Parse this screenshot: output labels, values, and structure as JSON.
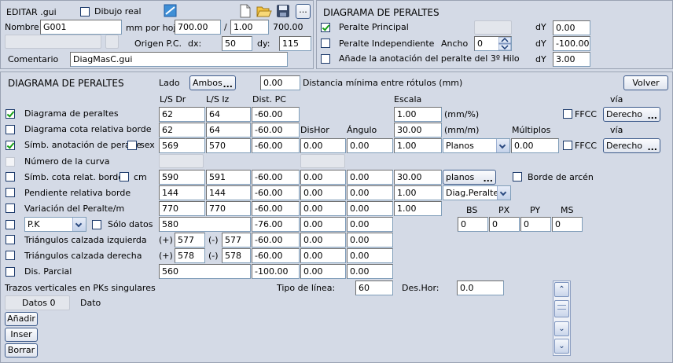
{
  "editar": {
    "title": "EDITAR .gui",
    "dibujo_real_label": "Dibujo real",
    "dibujo_real_checked": false,
    "nombre_label": "Nombre:",
    "nombre_value": "G001",
    "mm_por_hoja_label": "mm por hoja:",
    "mm_por_hoja_value": "700.00",
    "slash": "/",
    "ratio_value": "1.00",
    "ratio_result": "700.00",
    "origen_label": "Origen P.C.",
    "dx_label": "dx:",
    "dx_value": "50",
    "dy_label": "dy:",
    "dy_value": "115",
    "comentario_label": "Comentario",
    "comentario_value": "DiagMasC.gui",
    "browse_label": "..."
  },
  "diagrama_top": {
    "title": "DIAGRAMA DE PERALTES",
    "rows": [
      {
        "label": "Peralte Principal",
        "checked": true,
        "dy_label": "dY",
        "dy_value": "0.00"
      },
      {
        "label": "Peralte Independiente",
        "checked": false,
        "ancho_label": "Ancho",
        "ancho_value": "0",
        "dy_label": "dY",
        "dy_value": "-100.00"
      },
      {
        "label": "Añade la anotación del peralte del 3º Hilo",
        "checked": false,
        "dy_label": "dY",
        "dy_value": "3.00"
      }
    ]
  },
  "main": {
    "title": "DIAGRAMA DE PERALTES",
    "lado_label": "Lado",
    "lado_button": "Ambos",
    "dist_value": "0.00",
    "dist_label": "Distancia mínima entre rótulos (mm)",
    "volver_label": "Volver",
    "headers": {
      "ls_dr": "L/S Dr",
      "ls_iz": "L/S Iz",
      "dist_pc": "Dist. PC",
      "escala": "Escala",
      "via": "vía",
      "dishor": "DisHor",
      "angulo": "Ángulo",
      "multiplos": "Múltiplos",
      "via2": "vía"
    },
    "rows": [
      {
        "label": "Diagrama de peraltes",
        "checked": true,
        "dr": "62",
        "iz": "64",
        "pc": "-60.00",
        "escala": "1.00",
        "unit": "(mm/%)",
        "ffcc_label": "FFCC",
        "ffcc_checked": false,
        "via_button": "Derecho"
      },
      {
        "label": "Diagrama cota relativa borde",
        "checked": false,
        "dr": "62",
        "iz": "64",
        "pc": "-60.00",
        "escala": "30.00",
        "unit": "(mm/m)"
      },
      {
        "label": "Símb. anotación de peralte",
        "checked": true,
        "sex_label": "sex",
        "sex_checked": false,
        "dr": "569",
        "iz": "570",
        "pc": "-60.00",
        "dishor": "0.00",
        "angulo": "0.00",
        "escala": "1.00",
        "select": "Planos",
        "multiplos": "0.00",
        "ffcc_label": "FFCC",
        "ffcc_checked": false,
        "via_button": "Derecho"
      },
      {
        "label": "Número de la curva",
        "checked": false
      },
      {
        "label": "Símb. cota relat. borde",
        "checked": false,
        "cm_label": "cm",
        "cm_checked": false,
        "dr": "590",
        "iz": "591",
        "pc": "-60.00",
        "dishor": "0.00",
        "angulo": "0.00",
        "escala": "30.00",
        "button": "planos",
        "borde_label": "Borde de arcén",
        "borde_checked": false
      },
      {
        "label": "Pendiente relativa borde",
        "checked": false,
        "dr": "144",
        "iz": "144",
        "pc": "-60.00",
        "dishor": "0.00",
        "angulo": "0.00",
        "escala": "1.00",
        "select": "Diag.Peraltes"
      },
      {
        "label": "Variación del Peralte/m",
        "checked": false,
        "dr": "770",
        "iz": "770",
        "pc": "-60.00",
        "dishor": "0.00",
        "angulo": "0.00",
        "escala": "1.00"
      },
      {
        "label": "",
        "checked": false,
        "select": "P.K",
        "solo_label": "Sólo datos",
        "solo_checked": false,
        "dr": "580",
        "pc": "-76.00",
        "dishor": "0.00",
        "angulo": "0.00"
      },
      {
        "label": "Triángulos calzada izquierda",
        "checked": false,
        "plus": "(+)",
        "dr": "577",
        "minus": "(-)",
        "iz": "577",
        "pc": "-60.00",
        "dishor": "0.00",
        "angulo": "0.00"
      },
      {
        "label": "Triángulos calzada derecha",
        "checked": false,
        "plus": "(+)",
        "dr": "578",
        "minus": "(-)",
        "iz": "578",
        "pc": "-60.00",
        "dishor": "0.00",
        "angulo": "0.00"
      },
      {
        "label": "Dis. Parcial",
        "checked": false,
        "dr": "560",
        "pc": "-100.00",
        "dishor": "0.00",
        "angulo": "0.00"
      }
    ],
    "bs_headers": [
      "BS",
      "PX",
      "PY",
      "MS"
    ],
    "bs_values": [
      "0",
      "0",
      "0",
      "0"
    ],
    "trazos_label": "Trazos verticales en PKs singulares",
    "tipo_linea_label": "Tipo de línea:",
    "tipo_linea_value": "60",
    "des_hor_label": "Des.Hor:",
    "des_hor_value": "0.0",
    "datos_label": "Datos 0",
    "dato_label": "Dato",
    "anadir_label": "Añadir",
    "inser_label": "Inser",
    "borrar_label": "Borrar"
  }
}
